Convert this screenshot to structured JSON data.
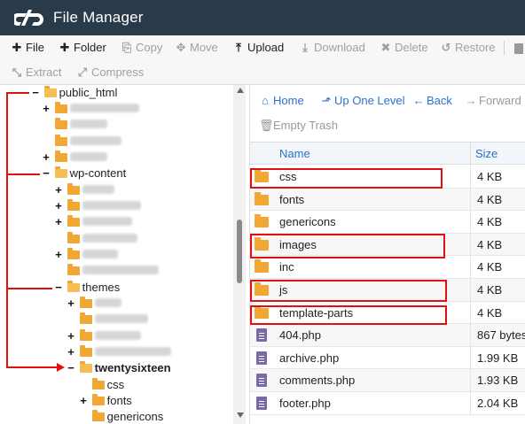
{
  "app": {
    "title": "File Manager",
    "logo_icon": "cpanel-logo-icon"
  },
  "toolbar": {
    "row1": [
      {
        "id": "file",
        "label": "File",
        "icon": "plus-icon",
        "glyph": "+",
        "enabled": true
      },
      {
        "id": "folder",
        "label": "Folder",
        "icon": "plus-icon",
        "glyph": "+",
        "enabled": true
      },
      {
        "id": "copy",
        "label": "Copy",
        "icon": "copy-icon",
        "glyph": "⎘",
        "enabled": false
      },
      {
        "id": "move",
        "label": "Move",
        "icon": "move-icon",
        "glyph": "✥",
        "enabled": false
      },
      {
        "id": "upload",
        "label": "Upload",
        "icon": "upload-icon",
        "glyph": "⤒",
        "enabled": true
      },
      {
        "id": "download",
        "label": "Download",
        "icon": "download-icon",
        "glyph": "⤓",
        "enabled": false
      },
      {
        "id": "delete",
        "label": "Delete",
        "icon": "close-icon",
        "glyph": "✖",
        "enabled": false
      },
      {
        "id": "restore",
        "label": "Restore",
        "icon": "restore-icon",
        "glyph": "↺",
        "enabled": false
      }
    ],
    "row2": [
      {
        "id": "extract",
        "label": "Extract",
        "icon": "extract-icon",
        "glyph": "⤡",
        "enabled": false
      },
      {
        "id": "compress",
        "label": "Compress",
        "icon": "compress-icon",
        "glyph": "⤢",
        "enabled": false
      }
    ]
  },
  "tree": [
    {
      "toggle": "−",
      "label": "public_html",
      "open": true,
      "bold": false
    },
    {
      "toggle": "+",
      "label": "",
      "open": false,
      "blurred": true
    },
    {
      "toggle": "",
      "label": "",
      "open": false,
      "blurred": true
    },
    {
      "toggle": "",
      "label": "",
      "open": false,
      "blurred": true
    },
    {
      "toggle": "+",
      "label": "",
      "open": false,
      "blurred": true
    },
    {
      "toggle": "−",
      "label": "wp-content",
      "open": true,
      "bold": false
    },
    {
      "toggle": "+",
      "label": "",
      "open": false,
      "blurred": true
    },
    {
      "toggle": "+",
      "label": "",
      "open": false,
      "blurred": true
    },
    {
      "toggle": "+",
      "label": "",
      "open": false,
      "blurred": true
    },
    {
      "toggle": "",
      "label": "",
      "open": false,
      "blurred": true
    },
    {
      "toggle": "+",
      "label": "",
      "open": false,
      "blurred": true
    },
    {
      "toggle": "",
      "label": "",
      "open": false,
      "blurred": true
    },
    {
      "toggle": "−",
      "label": "themes",
      "open": true,
      "bold": false
    },
    {
      "toggle": "+",
      "label": "",
      "open": false,
      "blurred": true
    },
    {
      "toggle": "",
      "label": "",
      "open": false,
      "blurred": true
    },
    {
      "toggle": "+",
      "label": "",
      "open": false,
      "blurred": true
    },
    {
      "toggle": "+",
      "label": "",
      "open": false,
      "blurred": true
    },
    {
      "toggle": "−",
      "label": "twentysixteen",
      "open": true,
      "bold": true
    },
    {
      "toggle": "",
      "label": "css",
      "open": false,
      "bold": false
    },
    {
      "toggle": "+",
      "label": "fonts",
      "open": false,
      "bold": false
    },
    {
      "toggle": "",
      "label": "genericons",
      "open": false,
      "bold": false
    }
  ],
  "actions": {
    "home": "Home",
    "up_one_level": "Up One Level",
    "back": "Back",
    "forward": "Forward",
    "empty_trash": "Empty Trash"
  },
  "table": {
    "headers": {
      "name": "Name",
      "size": "Size"
    },
    "rows": [
      {
        "type": "folder",
        "name": "css",
        "size": "4 KB"
      },
      {
        "type": "folder",
        "name": "fonts",
        "size": "4 KB"
      },
      {
        "type": "folder",
        "name": "genericons",
        "size": "4 KB"
      },
      {
        "type": "folder",
        "name": "images",
        "size": "4 KB"
      },
      {
        "type": "folder",
        "name": "inc",
        "size": "4 KB"
      },
      {
        "type": "folder",
        "name": "js",
        "size": "4 KB"
      },
      {
        "type": "folder",
        "name": "template-parts",
        "size": "4 KB"
      },
      {
        "type": "file",
        "name": "404.php",
        "size": "867 bytes"
      },
      {
        "type": "file",
        "name": "archive.php",
        "size": "1.99 KB"
      },
      {
        "type": "file",
        "name": "comments.php",
        "size": "1.93 KB"
      },
      {
        "type": "file",
        "name": "footer.php",
        "size": "2.04 KB"
      }
    ]
  },
  "colors": {
    "header_bg": "#293a4a",
    "link": "#2a72c8",
    "folder": "#f0a733",
    "annotation": "#e10f0f"
  }
}
